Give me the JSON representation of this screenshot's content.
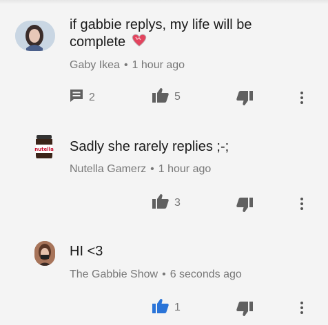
{
  "comments": [
    {
      "text_line1": "if gabbie replys, my life will be",
      "text_line2": "complete",
      "emoji": "heart-emoji",
      "author": "Gaby Ikea",
      "time": "1 hour ago",
      "replies": "2",
      "likes": "5",
      "like_color": "#606060"
    },
    {
      "text": "Sadly she rarely replies ;-;",
      "author": "Nutella Gamerz",
      "time": "1 hour ago",
      "likes": "3",
      "like_color": "#606060"
    },
    {
      "text": "HI <3",
      "author": "The Gabbie Show",
      "time": "6 seconds ago",
      "likes": "1",
      "like_color": "#2a74d8"
    }
  ],
  "icons": {
    "reply": "reply-icon",
    "like": "thumbs-up-icon",
    "dislike": "thumbs-down-icon",
    "menu": "more-vert-icon"
  },
  "colors": {
    "background": "#f4f4f4",
    "text": "#1a1a1a",
    "meta": "#777777",
    "like_active": "#2a74d8",
    "heart": "#e3445e"
  },
  "meta_separator": "•"
}
